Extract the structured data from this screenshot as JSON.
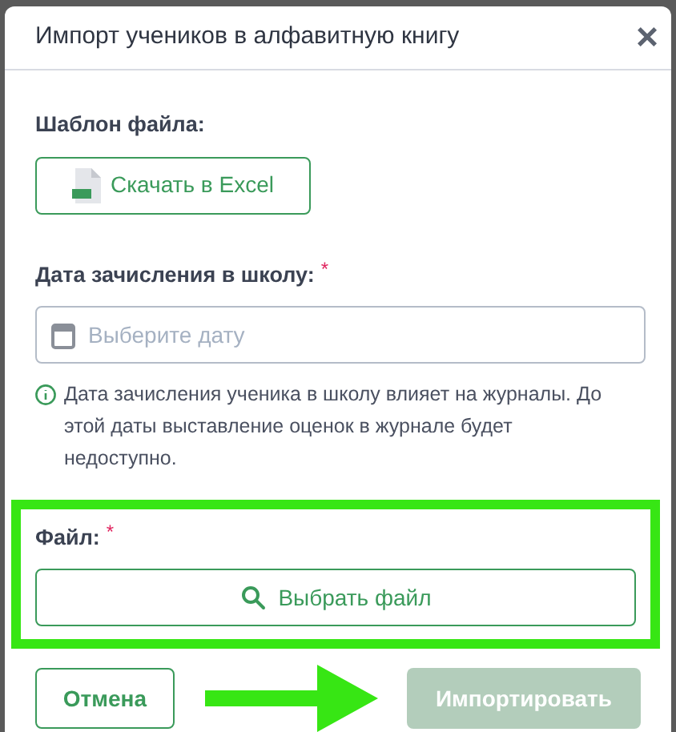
{
  "dialog": {
    "title": "Импорт учеников в алфавитную книгу",
    "close": "×"
  },
  "template": {
    "label": "Шаблон файла:",
    "button": "Скачать в Excel"
  },
  "date": {
    "label": "Дата зачисления в школу:",
    "required_mark": "*",
    "placeholder": "Выберите дату",
    "hint": "Дата зачисления ученика в школу влияет на журналы. До этой даты выставление оценок в журнале будет недоступно."
  },
  "file": {
    "label": "Файл:",
    "required_mark": "*",
    "button": "Выбрать файл"
  },
  "footer": {
    "cancel": "Отмена",
    "import": "Импортировать",
    "import_disabled": true
  }
}
